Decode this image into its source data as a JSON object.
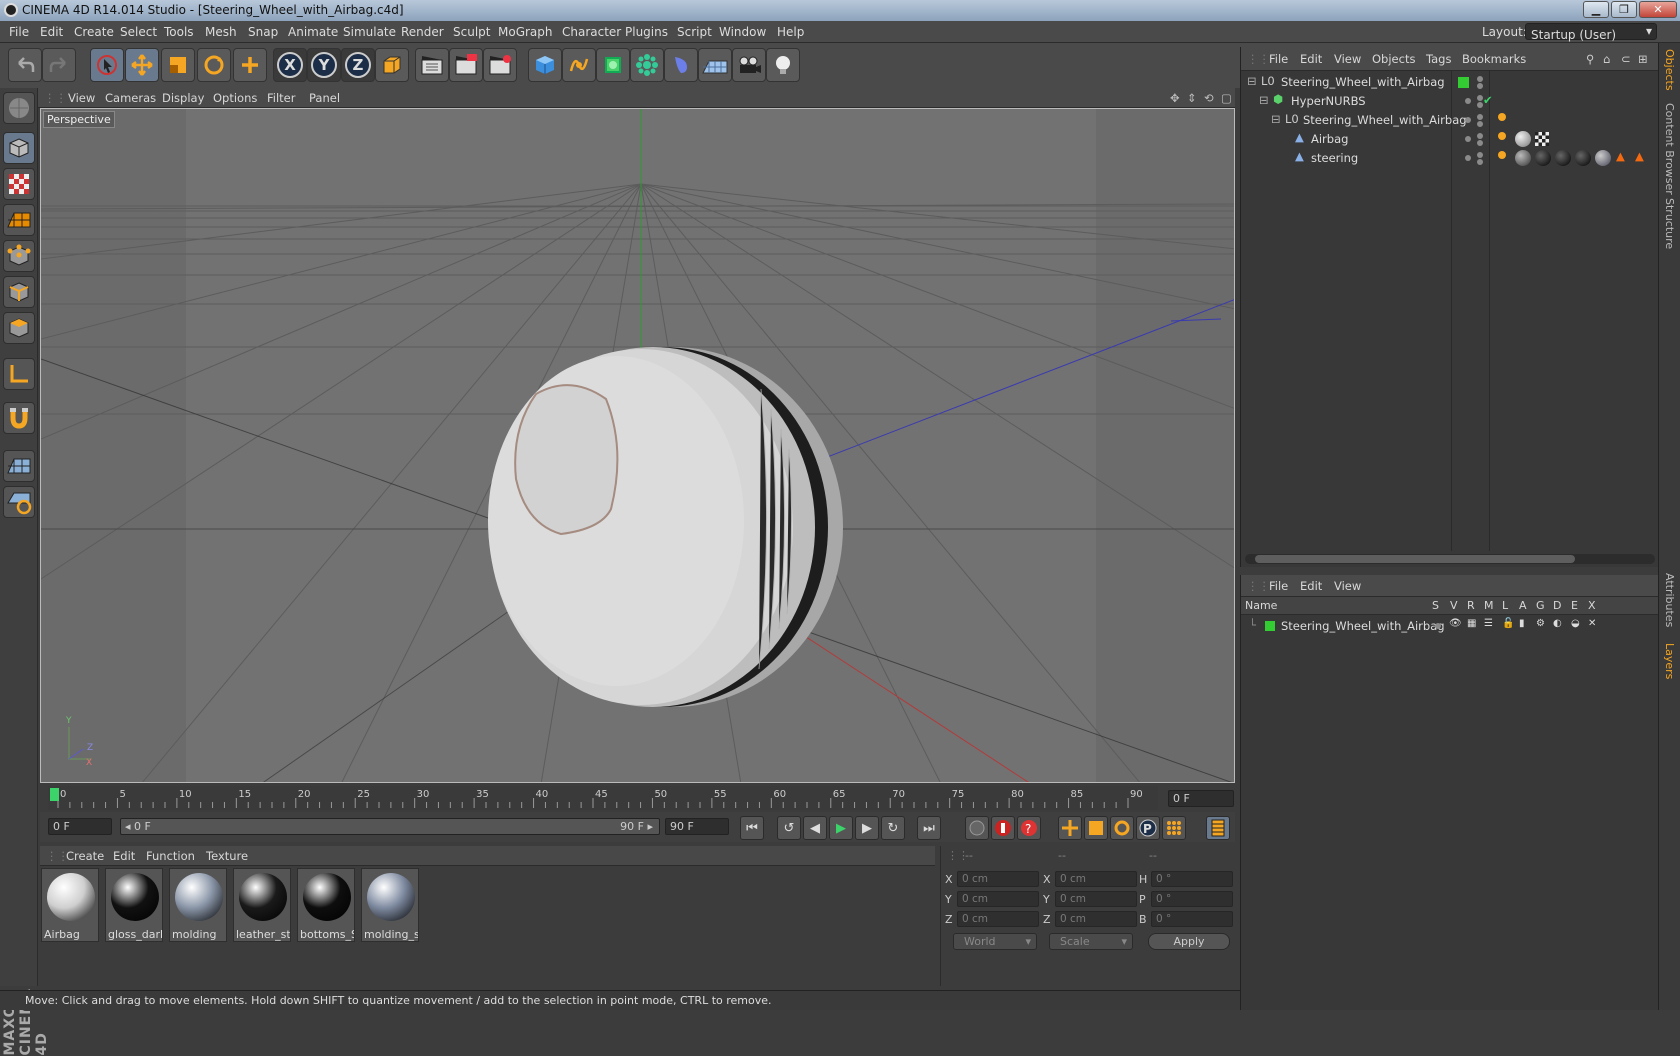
{
  "window": {
    "title": "CINEMA 4D R14.014 Studio - [Steering_Wheel_with_Airbag.c4d]",
    "controls": [
      "minimize-icon",
      "restore-icon",
      "close-icon"
    ],
    "minimize": "▁",
    "restore": "❐",
    "close": "✕"
  },
  "menubar": {
    "items": [
      "File",
      "Edit",
      "Create",
      "Select",
      "Tools",
      "Mesh",
      "Snap",
      "Animate",
      "Simulate",
      "Render",
      "Sculpt",
      "MoGraph",
      "Character",
      "Plugins",
      "Script",
      "Window",
      "Help"
    ],
    "layout_label": "Layout:",
    "layout_value": "Startup (User)"
  },
  "toolbar": {
    "icons": [
      "undo-icon",
      "redo-icon",
      "live-selection-icon",
      "move-icon",
      "scale-icon",
      "rotate-icon",
      "add-icon",
      "x-axis-icon",
      "y-axis-icon",
      "z-axis-icon",
      "coordinate-system-icon",
      "render-view-icon",
      "render-picture-viewer-icon",
      "edit-render-settings-icon",
      "cube-icon",
      "spline-pen-icon",
      "nurbs-icon",
      "array-icon",
      "deformer-icon",
      "floor-icon",
      "camera-icon",
      "light-icon"
    ],
    "axis_x": "X",
    "axis_y": "Y",
    "axis_z": "Z"
  },
  "left_tools": [
    "make-editable-icon",
    "model-mode-icon",
    "texture-mode-icon",
    "workplane-icon",
    "points-mode-icon",
    "edges-mode-icon",
    "polygons-mode-icon",
    "axis-mode-icon",
    "magnet-icon",
    "snap-grid-icon",
    "locked-workplane-icon"
  ],
  "viewport": {
    "menu": [
      "View",
      "Cameras",
      "Display",
      "Options",
      "Filter",
      "Panel"
    ],
    "label": "Perspective",
    "axis_labels": {
      "y": "Y",
      "z": "Z",
      "x": "X"
    },
    "colors": {
      "bg": "#6b6b6b",
      "grid": "#5a5a5a",
      "x_axis": "#b23b3b",
      "y_axis": "#2e9a2e",
      "z_axis": "#3a3ab0"
    }
  },
  "timeline": {
    "ticks": [
      "0",
      "5",
      "10",
      "15",
      "20",
      "25",
      "30",
      "35",
      "40",
      "45",
      "50",
      "55",
      "60",
      "65",
      "70",
      "75",
      "80",
      "85",
      "90"
    ],
    "current_frame_field": "0 F"
  },
  "transport": {
    "start_field": "0 F",
    "range_start": "◂ 0 F",
    "range_end": "90 F ▸",
    "end_field": "90 F",
    "buttons": [
      "go-to-start-icon",
      "previous-key-icon",
      "previous-frame-icon",
      "play-icon",
      "next-frame-icon",
      "next-key-icon",
      "go-to-end-icon"
    ],
    "glyphs": {
      "start": "⏮",
      "prevkey": "↺",
      "prevframe": "◀",
      "play": "▶",
      "nextframe": "▶",
      "nextkey": "↻",
      "end": "⏭"
    }
  },
  "materials": {
    "menu": [
      "Create",
      "Edit",
      "Function",
      "Texture"
    ],
    "items": [
      {
        "label": "Airbag",
        "color": "#cfcfcf"
      },
      {
        "label": "gloss_dark",
        "color": "#111111"
      },
      {
        "label": "molding",
        "color": "#8a96a8"
      },
      {
        "label": "leather_ste",
        "color": "#1a1a1a"
      },
      {
        "label": "bottoms_S",
        "color": "#0e0e0e"
      },
      {
        "label": "molding_st",
        "color": "#7e8aa0"
      }
    ]
  },
  "coordinates": {
    "header": [
      "--",
      "--",
      "--"
    ],
    "rows": [
      {
        "a": "X",
        "av": "0 cm",
        "b": "X",
        "bv": "0 cm",
        "c": "H",
        "cv": "0 °"
      },
      {
        "a": "Y",
        "av": "0 cm",
        "b": "Y",
        "bv": "0 cm",
        "c": "P",
        "cv": "0 °"
      },
      {
        "a": "Z",
        "av": "0 cm",
        "b": "Z",
        "bv": "0 cm",
        "c": "B",
        "cv": "0 °"
      }
    ],
    "world_select": "World",
    "scale_select": "Scale",
    "apply_label": "Apply"
  },
  "objects": {
    "menu": [
      "File",
      "Edit",
      "View",
      "Objects",
      "Tags",
      "Bookmarks"
    ],
    "tree": [
      {
        "name": "Steering_Wheel_with_Airbag",
        "icon": "null-object-icon"
      },
      {
        "name": "HyperNURBS",
        "icon": "hypernurbs-icon"
      },
      {
        "name": "Steering_Wheel_with_Airbag",
        "icon": "null-object-icon"
      },
      {
        "name": "Airbag",
        "icon": "polygon-object-icon"
      },
      {
        "name": "steering",
        "icon": "polygon-object-icon"
      }
    ],
    "check": "✔"
  },
  "layers": {
    "menu": [
      "File",
      "Edit",
      "View"
    ],
    "columns": [
      "Name",
      "S",
      "V",
      "R",
      "M",
      "L",
      "A",
      "G",
      "D",
      "E",
      "X"
    ],
    "row": {
      "name": "Steering_Wheel_with_Airbag",
      "color": "#33cc33"
    }
  },
  "side_tabs": [
    "Objects",
    "Content Browser",
    "Structure",
    "Attributes",
    "Layers"
  ],
  "brand": "MAXON CINEMA 4D",
  "status": "Move: Click and drag to move elements. Hold down SHIFT to quantize movement / add to the selection in point mode, CTRL to remove."
}
